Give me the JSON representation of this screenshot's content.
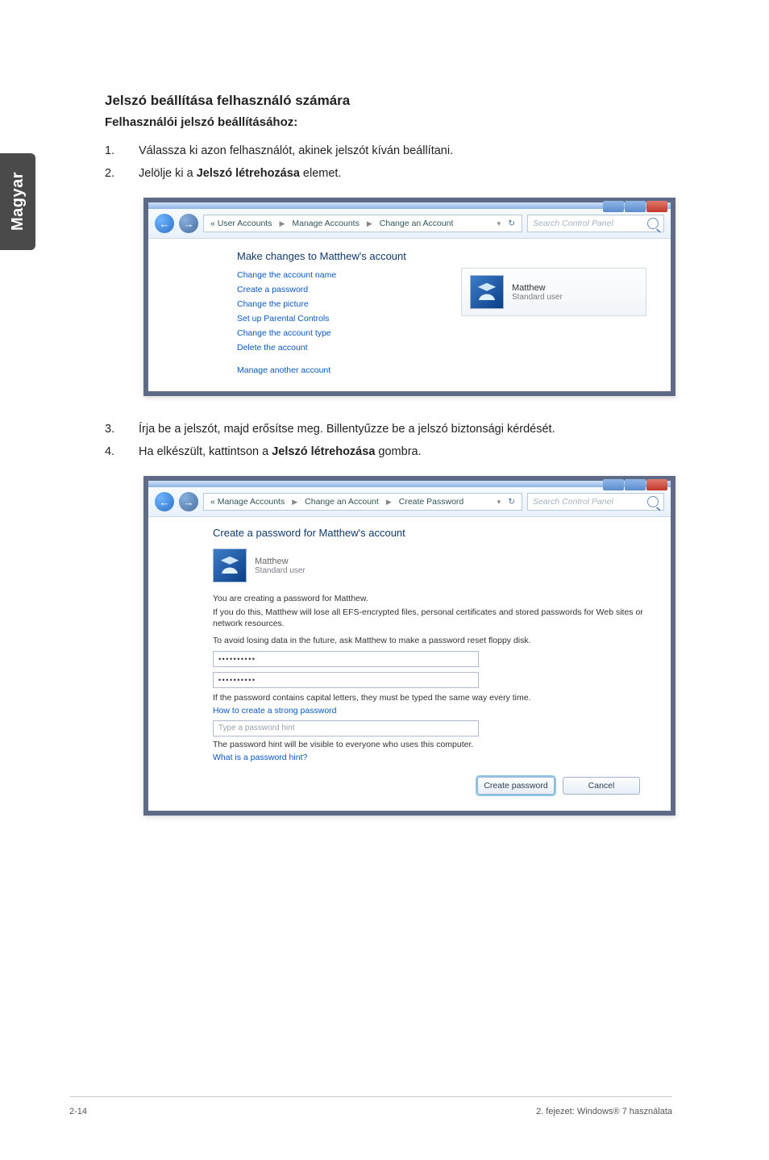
{
  "side_tab": "Magyar",
  "headings": {
    "title": "Jelszó beállítása felhasználó számára",
    "subtitle": "Felhasználói jelszó beállításához:"
  },
  "steps": {
    "s1": {
      "num": "1.",
      "text": "Válassza ki azon felhasználót, akinek jelszót kíván beállítani."
    },
    "s2": {
      "num": "2.",
      "prefix": "Jelölje ki a ",
      "bold": "Jelszó létrehozása",
      "suffix": " elemet."
    },
    "s3": {
      "num": "3.",
      "text": "Írja be a jelszót, majd erősítse meg. Billentyűzze be a jelszó biztonsági kérdését."
    },
    "s4": {
      "num": "4.",
      "prefix": "Ha elkészült, kattintson a ",
      "bold": "Jelszó létrehozása",
      "suffix": " gombra."
    }
  },
  "shot1": {
    "crumb_parts": {
      "a": "« User Accounts",
      "b": "Manage Accounts",
      "c": "Change an Account"
    },
    "search_placeholder": "Search Control Panel",
    "heading": "Make changes to Matthew's account",
    "links": {
      "l1": "Change the account name",
      "l2": "Create a password",
      "l3": "Change the picture",
      "l4": "Set up Parental Controls",
      "l5": "Change the account type",
      "l6": "Delete the account"
    },
    "another": "Manage another account",
    "account": {
      "name": "Matthew",
      "type": "Standard user"
    }
  },
  "shot2": {
    "crumb_parts": {
      "a": "« Manage Accounts",
      "b": "Change an Account",
      "c": "Create Password"
    },
    "search_placeholder": "Search Control Panel",
    "heading": "Create a password for Matthew's account",
    "account": {
      "name": "Matthew",
      "type": "Standard user"
    },
    "creating_for": "You are creating a password for Matthew.",
    "warn_line1": "If you do this, Matthew will lose all EFS-encrypted files, personal certificates and stored passwords for Web sites or network resources.",
    "warn_line2": "To avoid losing data in the future, ask Matthew to make a password reset floppy disk.",
    "pwd1": "••••••••••",
    "pwd2": "••••••••••",
    "capnote": "If the password contains capital letters, they must be typed the same way every time.",
    "howto": "How to create a strong password",
    "hint_placeholder": "Type a password hint",
    "hint_note": "The password hint will be visible to everyone who uses this computer.",
    "hint_q": "What is a password hint?",
    "buttons": {
      "create": "Create password",
      "cancel": "Cancel"
    }
  },
  "footer": {
    "left": "2-14",
    "right": "2. fejezet: Windows® 7 használata"
  }
}
